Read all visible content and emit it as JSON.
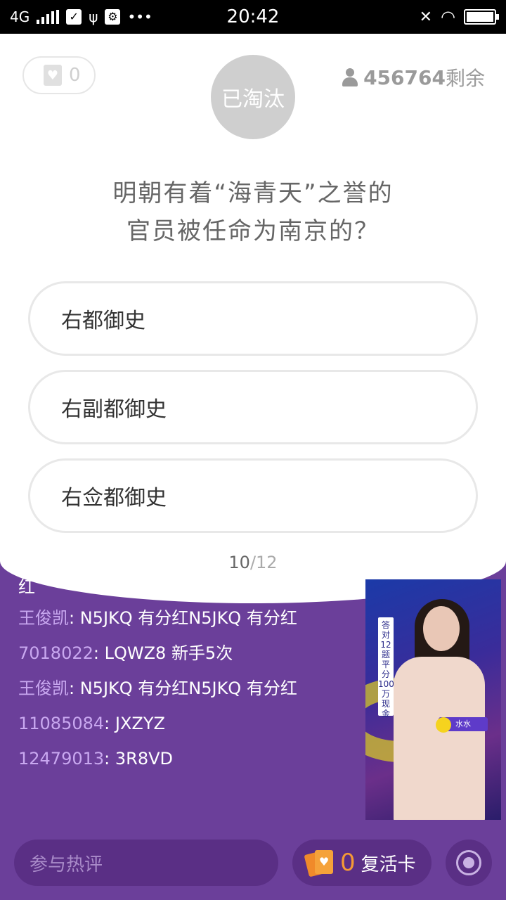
{
  "status_bar": {
    "network": "4G",
    "time": "20:42",
    "more": "•••",
    "battery_level": 1.0
  },
  "header": {
    "lives_count": "0",
    "status": "已淘汰",
    "remaining_count": "456764",
    "remaining_label": "剩余"
  },
  "question": {
    "line1": "明朝有着“海青天”之誉的",
    "line2": "官员被任命为南京的？"
  },
  "options": [
    {
      "label": "右都御史"
    },
    {
      "label": "右副都御史"
    },
    {
      "label": "右佥都御史"
    }
  ],
  "progress": {
    "current": "10",
    "total": "/12"
  },
  "comments": {
    "partial_tail": "红",
    "items": [
      {
        "user": "王俊凯",
        "text": ": N5JKQ  有分红N5JKQ  有分红"
      },
      {
        "user": "7018022",
        "text": ": LQWZ8 新手5次"
      },
      {
        "user": "王俊凯",
        "text": ": N5JKQ  有分红N5JKQ  有分红"
      },
      {
        "user": "11085084",
        "text": ": JXZYZ"
      },
      {
        "user": "12479013",
        "text": ": 3R8VD"
      }
    ]
  },
  "video": {
    "banner_text": "答对12题平分100万现金",
    "host_name": "水水"
  },
  "bottom_bar": {
    "comment_placeholder": "参与热评",
    "revive_count": "0",
    "revive_label": "复活卡"
  },
  "icons": {
    "heart-card": "heart-card-icon",
    "person": "person-icon",
    "revive-card": "revive-card-icon",
    "target": "target-icon"
  },
  "colors": {
    "background": "#6b3f9a",
    "accent_orange": "#f59a35",
    "username": "#c9a8f0",
    "eliminated_circle": "#cfcfcf"
  }
}
